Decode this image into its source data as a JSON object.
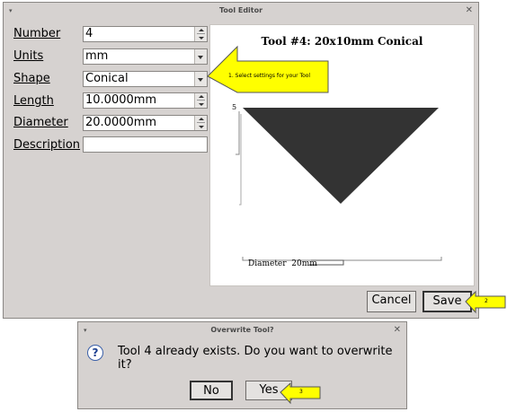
{
  "tool_editor": {
    "title": "Tool Editor",
    "fields": {
      "number_label": "Number",
      "number_value": "4",
      "units_label": "Units",
      "units_value": "mm",
      "shape_label": "Shape",
      "shape_value": "Conical",
      "length_label": "Length",
      "length_value": "10.0000mm",
      "diameter_label": "Diameter",
      "diameter_value": "20.0000mm",
      "description_label": "Description",
      "description_value": ""
    },
    "preview": {
      "title": "Tool #4: 20x10mm Conical",
      "diameter_label": "Diameter  20mm",
      "length_marker": "5"
    },
    "buttons": {
      "cancel_label": "Cancel",
      "save_label": "Save"
    }
  },
  "overwrite_dialog": {
    "title": "Overwrite Tool?",
    "message": "Tool 4 already exists.  Do you want to overwrite it?",
    "no_label": "No",
    "yes_label": "Yes"
  },
  "callouts": {
    "step1": "1. Select settings for your Tool",
    "step2": "2",
    "step3": "3"
  },
  "colors": {
    "window_bg": "#d6d2d0",
    "callout_fill": "#ffff00",
    "tool_shape": "#333333"
  }
}
